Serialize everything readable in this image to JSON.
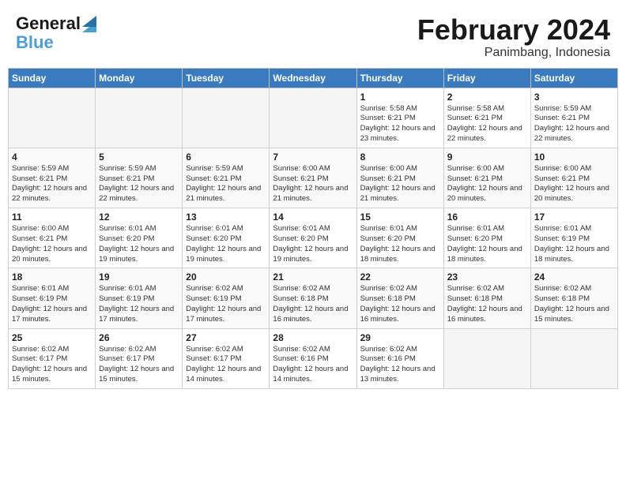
{
  "header": {
    "logo_line1": "General",
    "logo_line2": "Blue",
    "month": "February 2024",
    "location": "Panimbang, Indonesia"
  },
  "days_of_week": [
    "Sunday",
    "Monday",
    "Tuesday",
    "Wednesday",
    "Thursday",
    "Friday",
    "Saturday"
  ],
  "weeks": [
    [
      {
        "day": "",
        "empty": true
      },
      {
        "day": "",
        "empty": true
      },
      {
        "day": "",
        "empty": true
      },
      {
        "day": "",
        "empty": true
      },
      {
        "day": "1",
        "sunrise": "5:58 AM",
        "sunset": "6:21 PM",
        "daylight": "12 hours and 23 minutes."
      },
      {
        "day": "2",
        "sunrise": "5:58 AM",
        "sunset": "6:21 PM",
        "daylight": "12 hours and 22 minutes."
      },
      {
        "day": "3",
        "sunrise": "5:59 AM",
        "sunset": "6:21 PM",
        "daylight": "12 hours and 22 minutes."
      }
    ],
    [
      {
        "day": "4",
        "sunrise": "5:59 AM",
        "sunset": "6:21 PM",
        "daylight": "12 hours and 22 minutes."
      },
      {
        "day": "5",
        "sunrise": "5:59 AM",
        "sunset": "6:21 PM",
        "daylight": "12 hours and 22 minutes."
      },
      {
        "day": "6",
        "sunrise": "5:59 AM",
        "sunset": "6:21 PM",
        "daylight": "12 hours and 21 minutes."
      },
      {
        "day": "7",
        "sunrise": "6:00 AM",
        "sunset": "6:21 PM",
        "daylight": "12 hours and 21 minutes."
      },
      {
        "day": "8",
        "sunrise": "6:00 AM",
        "sunset": "6:21 PM",
        "daylight": "12 hours and 21 minutes."
      },
      {
        "day": "9",
        "sunrise": "6:00 AM",
        "sunset": "6:21 PM",
        "daylight": "12 hours and 20 minutes."
      },
      {
        "day": "10",
        "sunrise": "6:00 AM",
        "sunset": "6:21 PM",
        "daylight": "12 hours and 20 minutes."
      }
    ],
    [
      {
        "day": "11",
        "sunrise": "6:00 AM",
        "sunset": "6:21 PM",
        "daylight": "12 hours and 20 minutes."
      },
      {
        "day": "12",
        "sunrise": "6:01 AM",
        "sunset": "6:20 PM",
        "daylight": "12 hours and 19 minutes."
      },
      {
        "day": "13",
        "sunrise": "6:01 AM",
        "sunset": "6:20 PM",
        "daylight": "12 hours and 19 minutes."
      },
      {
        "day": "14",
        "sunrise": "6:01 AM",
        "sunset": "6:20 PM",
        "daylight": "12 hours and 19 minutes."
      },
      {
        "day": "15",
        "sunrise": "6:01 AM",
        "sunset": "6:20 PM",
        "daylight": "12 hours and 18 minutes."
      },
      {
        "day": "16",
        "sunrise": "6:01 AM",
        "sunset": "6:20 PM",
        "daylight": "12 hours and 18 minutes."
      },
      {
        "day": "17",
        "sunrise": "6:01 AM",
        "sunset": "6:19 PM",
        "daylight": "12 hours and 18 minutes."
      }
    ],
    [
      {
        "day": "18",
        "sunrise": "6:01 AM",
        "sunset": "6:19 PM",
        "daylight": "12 hours and 17 minutes."
      },
      {
        "day": "19",
        "sunrise": "6:01 AM",
        "sunset": "6:19 PM",
        "daylight": "12 hours and 17 minutes."
      },
      {
        "day": "20",
        "sunrise": "6:02 AM",
        "sunset": "6:19 PM",
        "daylight": "12 hours and 17 minutes."
      },
      {
        "day": "21",
        "sunrise": "6:02 AM",
        "sunset": "6:18 PM",
        "daylight": "12 hours and 16 minutes."
      },
      {
        "day": "22",
        "sunrise": "6:02 AM",
        "sunset": "6:18 PM",
        "daylight": "12 hours and 16 minutes."
      },
      {
        "day": "23",
        "sunrise": "6:02 AM",
        "sunset": "6:18 PM",
        "daylight": "12 hours and 16 minutes."
      },
      {
        "day": "24",
        "sunrise": "6:02 AM",
        "sunset": "6:18 PM",
        "daylight": "12 hours and 15 minutes."
      }
    ],
    [
      {
        "day": "25",
        "sunrise": "6:02 AM",
        "sunset": "6:17 PM",
        "daylight": "12 hours and 15 minutes."
      },
      {
        "day": "26",
        "sunrise": "6:02 AM",
        "sunset": "6:17 PM",
        "daylight": "12 hours and 15 minutes."
      },
      {
        "day": "27",
        "sunrise": "6:02 AM",
        "sunset": "6:17 PM",
        "daylight": "12 hours and 14 minutes."
      },
      {
        "day": "28",
        "sunrise": "6:02 AM",
        "sunset": "6:16 PM",
        "daylight": "12 hours and 14 minutes."
      },
      {
        "day": "29",
        "sunrise": "6:02 AM",
        "sunset": "6:16 PM",
        "daylight": "12 hours and 13 minutes."
      },
      {
        "day": "",
        "empty": true
      },
      {
        "day": "",
        "empty": true
      }
    ]
  ]
}
